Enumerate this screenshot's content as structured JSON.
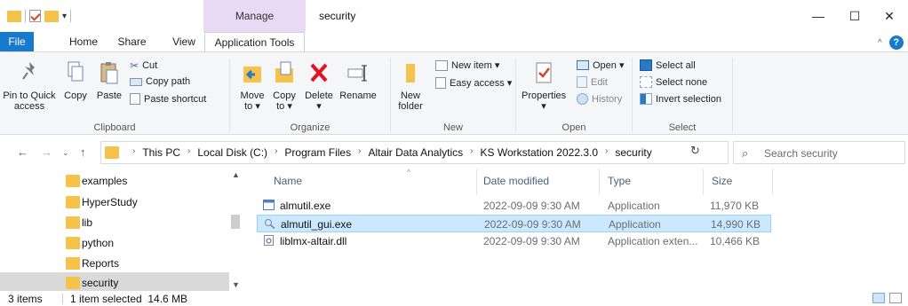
{
  "window": {
    "title": "security",
    "context_tab_group": "Manage",
    "controls": [
      "—",
      "☐",
      "✕"
    ]
  },
  "ribbon_tabs": [
    "File",
    "Home",
    "Share",
    "View",
    "Application Tools"
  ],
  "ribbon": {
    "clipboard": {
      "group_label": "Clipboard",
      "pin_label_1": "Pin to Quick",
      "pin_label_2": "access",
      "copy": "Copy",
      "paste": "Paste",
      "cut": "Cut",
      "copy_path": "Copy path",
      "paste_shortcut": "Paste shortcut"
    },
    "organize": {
      "group_label": "Organize",
      "move_to_1": "Move",
      "move_to_2": "to ▾",
      "copy_to_1": "Copy",
      "copy_to_2": "to ▾",
      "delete": "Delete",
      "rename": "Rename"
    },
    "new": {
      "group_label": "New",
      "new_folder_1": "New",
      "new_folder_2": "folder",
      "new_item": "New item ▾",
      "easy_access": "Easy access ▾"
    },
    "open": {
      "group_label": "Open",
      "properties": "Properties",
      "open": "Open ▾",
      "edit": "Edit",
      "history": "History"
    },
    "select": {
      "group_label": "Select",
      "select_all": "Select all",
      "select_none": "Select none",
      "invert_selection": "Invert selection"
    }
  },
  "address": {
    "crumbs": [
      "This PC",
      "Local Disk (C:)",
      "Program Files",
      "Altair Data Analytics",
      "KS Workstation 2022.3.0",
      "security"
    ],
    "search_placeholder": "Search security"
  },
  "nav_pane": {
    "items": [
      {
        "label": "examples",
        "selected": false
      },
      {
        "label": "HyperStudy",
        "selected": false
      },
      {
        "label": "lib",
        "selected": false
      },
      {
        "label": "python",
        "selected": false
      },
      {
        "label": "Reports",
        "selected": false
      },
      {
        "label": "security",
        "selected": true
      }
    ]
  },
  "file_list": {
    "columns": [
      "Name",
      "Date modified",
      "Type",
      "Size"
    ],
    "rows": [
      {
        "name": "almutil.exe",
        "date": "2022-09-09 9:30 AM",
        "type": "Application",
        "size": "11,970 KB",
        "selected": false,
        "icon": "exe-window-icon"
      },
      {
        "name": "almutil_gui.exe",
        "date": "2022-09-09 9:30 AM",
        "type": "Application",
        "size": "14,990 KB",
        "selected": true,
        "icon": "magnifier-app-icon"
      },
      {
        "name": "liblmx-altair.dll",
        "date": "2022-09-09 9:30 AM",
        "type": "Application exten...",
        "size": "10,466 KB",
        "selected": false,
        "icon": "dll-gear-icon"
      }
    ]
  },
  "status": {
    "item_count": "3 items",
    "selection": "1 item selected  14.6 MB"
  },
  "colors": {
    "accent": "#1979ca",
    "manage_tab": "#e8d9f5",
    "folder": "#f5c24c",
    "selection_bg": "#cce8ff",
    "nav_selected_bg": "#d9d9d9"
  }
}
